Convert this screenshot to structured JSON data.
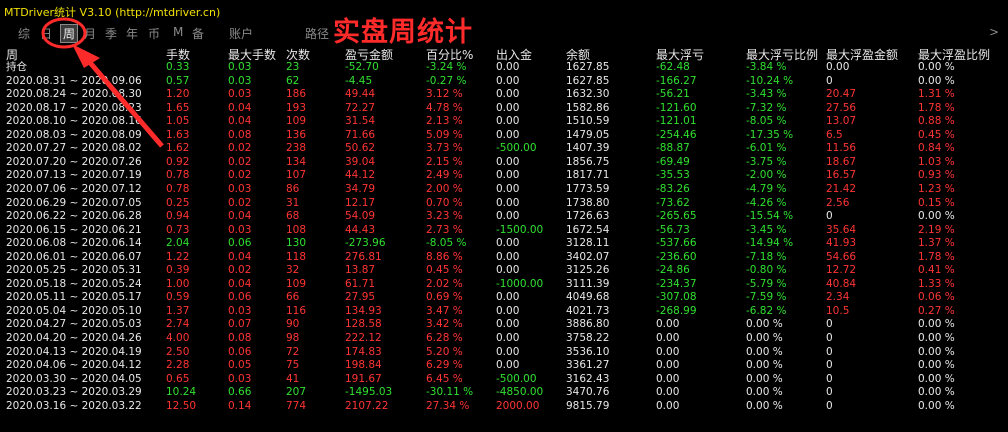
{
  "app_title": "MTDriver统计 V3.10 (http://mtdriver.cn)",
  "overlay_title": "实盘周统计",
  "tabs": [
    "综",
    "日",
    "周",
    "月",
    "季",
    "年",
    "币",
    "M",
    "备",
    "账户"
  ],
  "active_tab": "周",
  "path_label": "路径",
  "scroll_arrow": ">",
  "colors": {
    "positive": "#30e030",
    "negative": "#ff3434",
    "title": "#f0e000",
    "annotation": "#ff2a2a"
  },
  "headers": {
    "period": "周",
    "lots": "手数",
    "max_lots": "最大手数",
    "trades": "次数",
    "pnl_amount": "盈亏金额",
    "percent": "百分比%",
    "deposit": "出入金",
    "balance": "余额",
    "max_floating_loss": "最大浮亏",
    "max_floating_loss_ratio": "最大浮亏比例",
    "max_floating_profit": "最大浮盈金额",
    "max_floating_profit_ratio": "最大浮盈比例"
  },
  "rows": [
    {
      "period": "持仓",
      "lots": "0.33",
      "max_lots": "0.03",
      "trades": "23",
      "pnl": "-52.70",
      "pct": "-3.24 %",
      "dep": "0.00",
      "bal": "1627.85",
      "mfl": "-62.48",
      "mflr": "-3.84 %",
      "mfp": "0.00",
      "mfpr": "0.00 %",
      "c": "g"
    },
    {
      "period": "2020.08.31 ~ 2020.09.06",
      "lots": "0.57",
      "max_lots": "0.03",
      "trades": "62",
      "pnl": "-4.45",
      "pct": "-0.27 %",
      "dep": "0.00",
      "bal": "1627.85",
      "mfl": "-166.27",
      "mflr": "-10.24 %",
      "mfp": "0",
      "mfpr": "0.00 %",
      "c": "g"
    },
    {
      "period": "2020.08.24 ~ 2020.08.30",
      "lots": "1.20",
      "max_lots": "0.03",
      "trades": "186",
      "pnl": "49.44",
      "pct": "3.12 %",
      "dep": "0.00",
      "bal": "1632.30",
      "mfl": "-56.21",
      "mflr": "-3.43 %",
      "mfp": "20.47",
      "mfpr": "1.31 %",
      "c": "r"
    },
    {
      "period": "2020.08.17 ~ 2020.08.23",
      "lots": "1.65",
      "max_lots": "0.04",
      "trades": "193",
      "pnl": "72.27",
      "pct": "4.78 %",
      "dep": "0.00",
      "bal": "1582.86",
      "mfl": "-121.60",
      "mflr": "-7.32 %",
      "mfp": "27.56",
      "mfpr": "1.78 %",
      "c": "r"
    },
    {
      "period": "2020.08.10 ~ 2020.08.16",
      "lots": "1.05",
      "max_lots": "0.04",
      "trades": "109",
      "pnl": "31.54",
      "pct": "2.13 %",
      "dep": "0.00",
      "bal": "1510.59",
      "mfl": "-121.01",
      "mflr": "-8.05 %",
      "mfp": "13.07",
      "mfpr": "0.88 %",
      "c": "r"
    },
    {
      "period": "2020.08.03 ~ 2020.08.09",
      "lots": "1.63",
      "max_lots": "0.08",
      "trades": "136",
      "pnl": "71.66",
      "pct": "5.09 %",
      "dep": "0.00",
      "bal": "1479.05",
      "mfl": "-254.46",
      "mflr": "-17.35 %",
      "mfp": "6.5",
      "mfpr": "0.45 %",
      "c": "r"
    },
    {
      "period": "2020.07.27 ~ 2020.08.02",
      "lots": "1.62",
      "max_lots": "0.02",
      "trades": "238",
      "pnl": "50.62",
      "pct": "3.73 %",
      "dep": "-500.00",
      "bal": "1407.39",
      "mfl": "-88.87",
      "mflr": "-6.01 %",
      "mfp": "11.56",
      "mfpr": "0.84 %",
      "c": "r"
    },
    {
      "period": "2020.07.20 ~ 2020.07.26",
      "lots": "0.92",
      "max_lots": "0.02",
      "trades": "134",
      "pnl": "39.04",
      "pct": "2.15 %",
      "dep": "0.00",
      "bal": "1856.75",
      "mfl": "-69.49",
      "mflr": "-3.75 %",
      "mfp": "18.67",
      "mfpr": "1.03 %",
      "c": "r"
    },
    {
      "period": "2020.07.13 ~ 2020.07.19",
      "lots": "0.78",
      "max_lots": "0.02",
      "trades": "107",
      "pnl": "44.12",
      "pct": "2.49 %",
      "dep": "0.00",
      "bal": "1817.71",
      "mfl": "-35.53",
      "mflr": "-2.00 %",
      "mfp": "16.57",
      "mfpr": "0.93 %",
      "c": "r"
    },
    {
      "period": "2020.07.06 ~ 2020.07.12",
      "lots": "0.78",
      "max_lots": "0.03",
      "trades": "86",
      "pnl": "34.79",
      "pct": "2.00 %",
      "dep": "0.00",
      "bal": "1773.59",
      "mfl": "-83.26",
      "mflr": "-4.79 %",
      "mfp": "21.42",
      "mfpr": "1.23 %",
      "c": "r"
    },
    {
      "period": "2020.06.29 ~ 2020.07.05",
      "lots": "0.25",
      "max_lots": "0.02",
      "trades": "31",
      "pnl": "12.17",
      "pct": "0.70 %",
      "dep": "0.00",
      "bal": "1738.80",
      "mfl": "-73.62",
      "mflr": "-4.26 %",
      "mfp": "2.56",
      "mfpr": "0.15 %",
      "c": "r"
    },
    {
      "period": "2020.06.22 ~ 2020.06.28",
      "lots": "0.94",
      "max_lots": "0.04",
      "trades": "68",
      "pnl": "54.09",
      "pct": "3.23 %",
      "dep": "0.00",
      "bal": "1726.63",
      "mfl": "-265.65",
      "mflr": "-15.54 %",
      "mfp": "0",
      "mfpr": "0.00 %",
      "c": "r"
    },
    {
      "period": "2020.06.15 ~ 2020.06.21",
      "lots": "0.73",
      "max_lots": "0.03",
      "trades": "108",
      "pnl": "44.43",
      "pct": "2.73 %",
      "dep": "-1500.00",
      "bal": "1672.54",
      "mfl": "-56.73",
      "mflr": "-3.45 %",
      "mfp": "35.64",
      "mfpr": "2.19 %",
      "c": "r"
    },
    {
      "period": "2020.06.08 ~ 2020.06.14",
      "lots": "2.04",
      "max_lots": "0.06",
      "trades": "130",
      "pnl": "-273.96",
      "pct": "-8.05 %",
      "dep": "0.00",
      "bal": "3128.11",
      "mfl": "-537.66",
      "mflr": "-14.94 %",
      "mfp": "41.93",
      "mfpr": "1.37 %",
      "c": "g"
    },
    {
      "period": "2020.06.01 ~ 2020.06.07",
      "lots": "1.22",
      "max_lots": "0.04",
      "trades": "118",
      "pnl": "276.81",
      "pct": "8.86 %",
      "dep": "0.00",
      "bal": "3402.07",
      "mfl": "-236.60",
      "mflr": "-7.18 %",
      "mfp": "54.66",
      "mfpr": "1.78 %",
      "c": "r"
    },
    {
      "period": "2020.05.25 ~ 2020.05.31",
      "lots": "0.39",
      "max_lots": "0.02",
      "trades": "32",
      "pnl": "13.87",
      "pct": "0.45 %",
      "dep": "0.00",
      "bal": "3125.26",
      "mfl": "-24.86",
      "mflr": "-0.80 %",
      "mfp": "12.72",
      "mfpr": "0.41 %",
      "c": "r"
    },
    {
      "period": "2020.05.18 ~ 2020.05.24",
      "lots": "1.00",
      "max_lots": "0.04",
      "trades": "109",
      "pnl": "61.71",
      "pct": "2.02 %",
      "dep": "-1000.00",
      "bal": "3111.39",
      "mfl": "-234.37",
      "mflr": "-5.79 %",
      "mfp": "40.84",
      "mfpr": "1.33 %",
      "c": "r"
    },
    {
      "period": "2020.05.11 ~ 2020.05.17",
      "lots": "0.59",
      "max_lots": "0.06",
      "trades": "66",
      "pnl": "27.95",
      "pct": "0.69 %",
      "dep": "0.00",
      "bal": "4049.68",
      "mfl": "-307.08",
      "mflr": "-7.59 %",
      "mfp": "2.34",
      "mfpr": "0.06 %",
      "c": "r"
    },
    {
      "period": "2020.05.04 ~ 2020.05.10",
      "lots": "1.37",
      "max_lots": "0.03",
      "trades": "116",
      "pnl": "134.93",
      "pct": "3.47 %",
      "dep": "0.00",
      "bal": "4021.73",
      "mfl": "-268.99",
      "mflr": "-6.82 %",
      "mfp": "10.5",
      "mfpr": "0.27 %",
      "c": "r"
    },
    {
      "period": "2020.04.27 ~ 2020.05.03",
      "lots": "2.74",
      "max_lots": "0.07",
      "trades": "90",
      "pnl": "128.58",
      "pct": "3.42 %",
      "dep": "0.00",
      "bal": "3886.80",
      "mfl": "0.00",
      "mflr": "0.00 %",
      "mfp": "0",
      "mfpr": "0.00 %",
      "c": "r"
    },
    {
      "period": "2020.04.20 ~ 2020.04.26",
      "lots": "4.00",
      "max_lots": "0.08",
      "trades": "98",
      "pnl": "222.12",
      "pct": "6.28 %",
      "dep": "0.00",
      "bal": "3758.22",
      "mfl": "0.00",
      "mflr": "0.00 %",
      "mfp": "0",
      "mfpr": "0.00 %",
      "c": "r"
    },
    {
      "period": "2020.04.13 ~ 2020.04.19",
      "lots": "2.50",
      "max_lots": "0.06",
      "trades": "72",
      "pnl": "174.83",
      "pct": "5.20 %",
      "dep": "0.00",
      "bal": "3536.10",
      "mfl": "0.00",
      "mflr": "0.00 %",
      "mfp": "0",
      "mfpr": "0.00 %",
      "c": "r"
    },
    {
      "period": "2020.04.06 ~ 2020.04.12",
      "lots": "2.28",
      "max_lots": "0.05",
      "trades": "75",
      "pnl": "198.84",
      "pct": "6.29 %",
      "dep": "0.00",
      "bal": "3361.27",
      "mfl": "0.00",
      "mflr": "0.00 %",
      "mfp": "0",
      "mfpr": "0.00 %",
      "c": "r"
    },
    {
      "period": "2020.03.30 ~ 2020.04.05",
      "lots": "0.65",
      "max_lots": "0.03",
      "trades": "41",
      "pnl": "191.67",
      "pct": "6.45 %",
      "dep": "-500.00",
      "bal": "3162.43",
      "mfl": "0.00",
      "mflr": "0.00 %",
      "mfp": "0",
      "mfpr": "0.00 %",
      "c": "r"
    },
    {
      "period": "2020.03.23 ~ 2020.03.29",
      "lots": "10.24",
      "max_lots": "0.66",
      "trades": "207",
      "pnl": "-1495.03",
      "pct": "-30.11 %",
      "dep": "-4850.00",
      "bal": "3470.76",
      "mfl": "0.00",
      "mflr": "0.00 %",
      "mfp": "0",
      "mfpr": "0.00 %",
      "c": "g"
    },
    {
      "period": "2020.03.16 ~ 2020.03.22",
      "lots": "12.50",
      "max_lots": "0.14",
      "trades": "774",
      "pnl": "2107.22",
      "pct": "27.34 %",
      "dep": "2000.00",
      "bal": "9815.79",
      "mfl": "0.00",
      "mflr": "0.00 %",
      "mfp": "0",
      "mfpr": "0.00 %",
      "c": "r"
    }
  ]
}
